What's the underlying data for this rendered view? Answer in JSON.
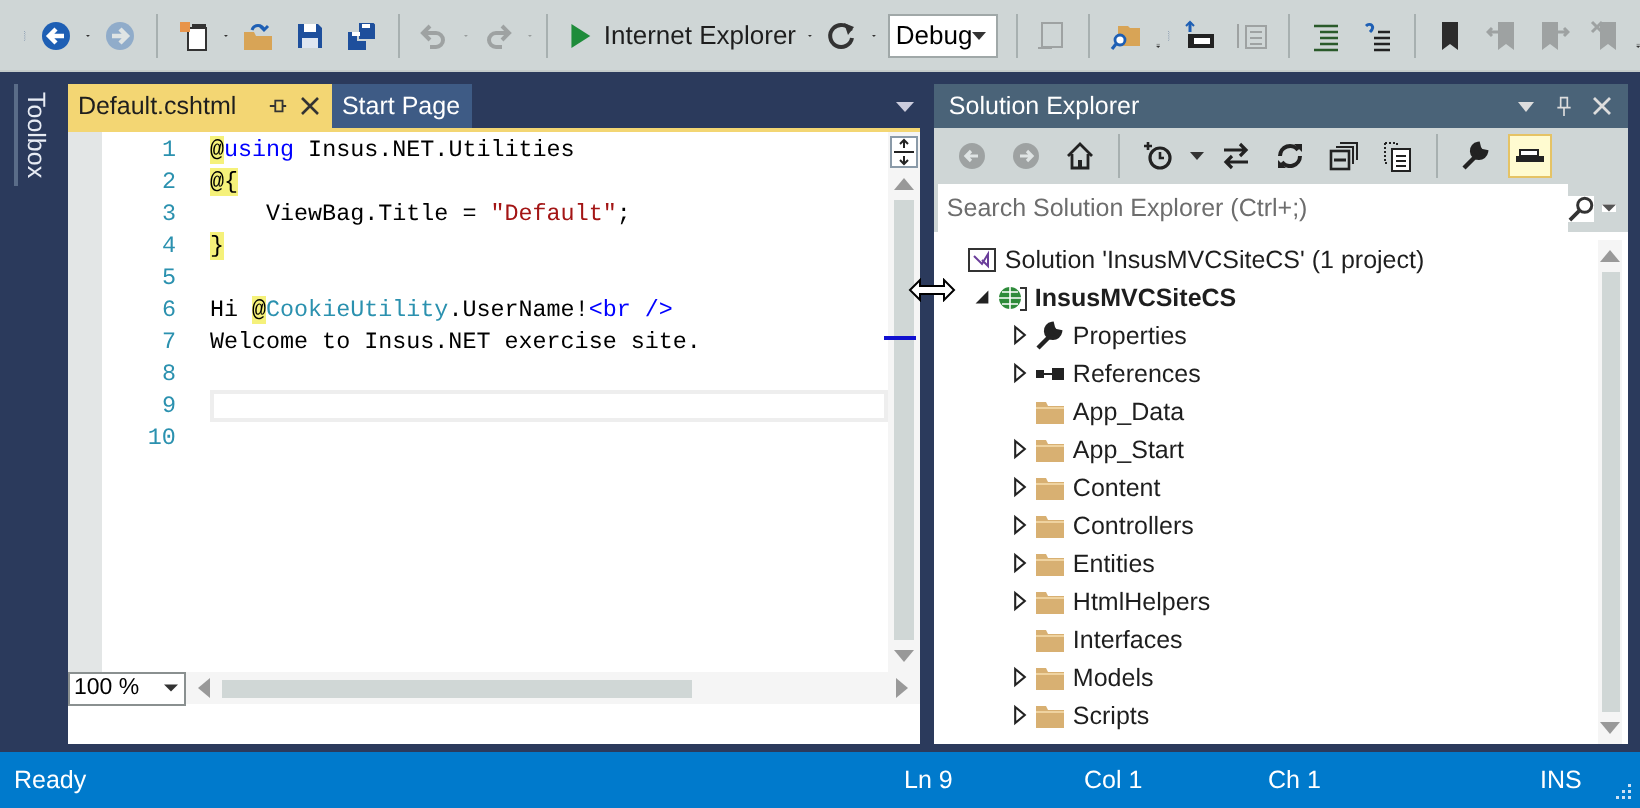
{
  "toolbar": [
    {
      "kind": "grip"
    },
    {
      "kind": "button",
      "disabled": false,
      "menu": true
    },
    {
      "kind": "button",
      "disabled": true,
      "menu": false
    },
    {
      "kind": "separator"
    },
    {
      "kind": "button",
      "disabled": false,
      "menu": true
    },
    {
      "kind": "button",
      "disabled": false,
      "menu": false
    },
    {
      "kind": "button",
      "disabled": false,
      "menu": false
    },
    {
      "kind": "button",
      "disabled": false,
      "menu": false
    },
    {
      "kind": "separator"
    },
    {
      "kind": "button",
      "disabled": true,
      "menu": true
    },
    {
      "kind": "button",
      "disabled": true,
      "menu": true
    },
    {
      "kind": "separator"
    },
    {
      "kind": "run",
      "label": "Internet Explorer"
    },
    {
      "kind": "button",
      "disabled": false,
      "menu": true
    },
    {
      "kind": "combo",
      "value": "Debug"
    },
    {
      "kind": "separator"
    },
    {
      "kind": "button",
      "disabled": true,
      "menu": false
    },
    {
      "kind": "separator"
    },
    {
      "kind": "button",
      "disabled": false,
      "menu": false
    },
    {
      "kind": "overflow"
    },
    {
      "kind": "grip"
    },
    {
      "kind": "button",
      "disabled": false,
      "menu": false
    },
    {
      "kind": "button",
      "disabled": true,
      "menu": false
    },
    {
      "kind": "separator"
    },
    {
      "kind": "button",
      "disabled": false,
      "menu": false
    },
    {
      "kind": "button",
      "disabled": false,
      "menu": false
    },
    {
      "kind": "separator"
    },
    {
      "kind": "button",
      "disabled": false,
      "menu": false
    },
    {
      "kind": "button",
      "disabled": true,
      "menu": false
    },
    {
      "kind": "button",
      "disabled": true,
      "menu": false
    },
    {
      "kind": "button",
      "disabled": true,
      "menu": false
    },
    {
      "kind": "overflow"
    }
  ],
  "toolbox": {
    "label": "Toolbox"
  },
  "editor": {
    "tabs": [
      {
        "label": "Default.cshtml",
        "selected": true
      },
      {
        "label": "Start Page",
        "selected": false
      }
    ],
    "lines": [
      {
        "number": "1",
        "current": false,
        "tokens": [
          {
            "kind": "razor",
            "text": "@"
          },
          {
            "kind": "keyword",
            "text": "using"
          },
          {
            "kind": "text",
            "text": " Insus.NET.Utilities"
          }
        ]
      },
      {
        "number": "2",
        "current": false,
        "tokens": [
          {
            "kind": "razor",
            "text": "@{"
          }
        ]
      },
      {
        "number": "3",
        "current": false,
        "tokens": [
          {
            "kind": "text",
            "text": "    ViewBag.Title = "
          },
          {
            "kind": "string",
            "text": "\"Default\""
          },
          {
            "kind": "text",
            "text": ";"
          }
        ]
      },
      {
        "number": "4",
        "current": false,
        "tokens": [
          {
            "kind": "razor",
            "text": "}"
          }
        ]
      },
      {
        "number": "5",
        "current": false
      },
      {
        "number": "6",
        "current": false,
        "tokens": [
          {
            "kind": "text",
            "text": "Hi "
          },
          {
            "kind": "razor",
            "text": "@"
          },
          {
            "kind": "type",
            "text": "CookieUtility"
          },
          {
            "kind": "text",
            "text": ".UserName!"
          },
          {
            "kind": "tag",
            "text": "<br />"
          }
        ]
      },
      {
        "number": "7",
        "current": false,
        "tokens": [
          {
            "kind": "text",
            "text": "Welcome to Insus.NET exercise site."
          }
        ]
      },
      {
        "number": "8",
        "current": false
      },
      {
        "number": "9",
        "current": true
      },
      {
        "number": "10",
        "current": false
      }
    ],
    "zoom": "100 %"
  },
  "solution_explorer": {
    "title": "Solution Explorer",
    "toolbar": [
      {
        "kind": "button",
        "disabled": true,
        "menu": false,
        "on": false
      },
      {
        "kind": "button",
        "disabled": true,
        "menu": false,
        "on": false
      },
      {
        "kind": "button",
        "disabled": false,
        "menu": false,
        "on": false
      },
      {
        "kind": "separator"
      },
      {
        "kind": "button",
        "disabled": false,
        "menu": true,
        "on": false
      },
      {
        "kind": "button",
        "disabled": false,
        "menu": false,
        "on": false
      },
      {
        "kind": "button",
        "disabled": false,
        "menu": false,
        "on": false
      },
      {
        "kind": "button",
        "disabled": false,
        "menu": false,
        "on": false
      },
      {
        "kind": "button",
        "disabled": false,
        "menu": false,
        "on": false
      },
      {
        "kind": "separator"
      },
      {
        "kind": "button",
        "disabled": false,
        "menu": false,
        "on": false
      },
      {
        "kind": "button",
        "disabled": false,
        "menu": false,
        "on": true
      }
    ],
    "search": {
      "placeholder": "Search Solution Explorer (Ctrl+;)"
    },
    "tree": [
      {
        "label": "Solution 'InsusMVCSiteCS' (1 project)",
        "kind": "solution",
        "expandable": false,
        "expanded": true,
        "children": [
          {
            "label": "InsusMVCSiteCS",
            "kind": "project",
            "expandable": true,
            "expanded": true,
            "children": [
              {
                "label": "Properties",
                "kind": "properties",
                "expandable": true,
                "expanded": false
              },
              {
                "label": "References",
                "kind": "references",
                "expandable": true,
                "expanded": false
              },
              {
                "label": "App_Data",
                "kind": "folder",
                "expandable": false
              },
              {
                "label": "App_Start",
                "kind": "folder",
                "expandable": true,
                "expanded": false
              },
              {
                "label": "Content",
                "kind": "folder",
                "expandable": true,
                "expanded": false
              },
              {
                "label": "Controllers",
                "kind": "folder",
                "expandable": true,
                "expanded": false
              },
              {
                "label": "Entities",
                "kind": "folder",
                "expandable": true,
                "expanded": false
              },
              {
                "label": "HtmlHelpers",
                "kind": "folder",
                "expandable": true,
                "expanded": false
              },
              {
                "label": "Interfaces",
                "kind": "folder",
                "expandable": false
              },
              {
                "label": "Models",
                "kind": "folder",
                "expandable": true,
                "expanded": false
              },
              {
                "label": "Scripts",
                "kind": "folder",
                "expandable": true,
                "expanded": false
              }
            ]
          }
        ]
      }
    ]
  },
  "status_bar": {
    "message": "Ready",
    "line": "Ln 9",
    "column": "Col 1",
    "character": "Ch 1",
    "mode": "INS"
  }
}
